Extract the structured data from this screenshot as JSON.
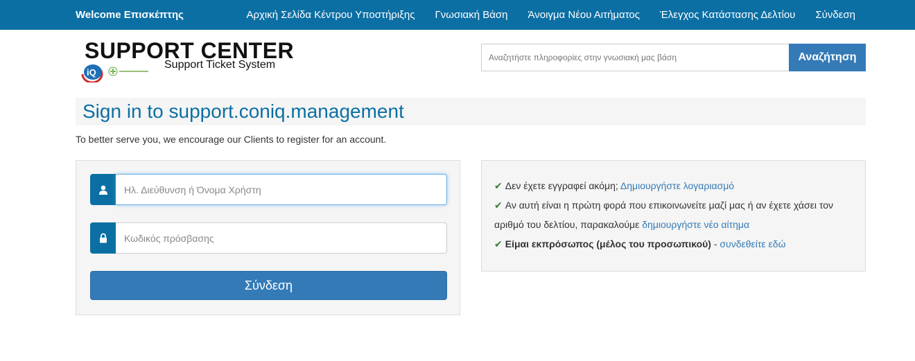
{
  "topbar": {
    "welcome": "Welcome Επισκέπτης",
    "nav": [
      "Αρχική Σελίδα Κέντρου Υποστήριξης",
      "Γνωσιακή Βάση",
      "Άνοιγμα Νέου Αιτήματος",
      "Έλεγχος Κατάστασης Δελτίου",
      "Σύνδεση"
    ]
  },
  "logo": {
    "brand": "SUPPORT CENTER",
    "tagline": "Support Ticket System",
    "badge": "iQ"
  },
  "search": {
    "placeholder": "Αναζητήστε πληροφορίες στην γνωσιακή μας βάση",
    "button": "Αναζήτηση"
  },
  "page": {
    "title": "Sign in to support.coniq.management",
    "intro": "To better serve you, we encourage our Clients to register for an account."
  },
  "login": {
    "username_placeholder": "Ηλ. Διεύθυνση ή Όνομα Χρήστη",
    "password_placeholder": "Κωδικός πρόσβασης",
    "submit": "Σύνδεση"
  },
  "info": {
    "line1_text": "Δεν έχετε εγγραφεί ακόμη;",
    "line1_link": "Δημιουργήστε λογαριασμό",
    "line2_text": "Αν αυτή είναι η πρώτη φορά που επικοινωνείτε μαζί μας ή αν έχετε χάσει τον αριθμό του δελτίου, παρακαλούμε",
    "line2_link": "δημιουργήστε νέο αίτημα",
    "line3_bold": "Είμαι εκπρόσωπος (μέλος του προσωπικού)",
    "line3_sep": "-",
    "line3_link": "συνδεθείτε εδώ"
  },
  "colors": {
    "topbar": "#0b6fa4",
    "primary": "#337ab7",
    "check": "#3a7d3a"
  },
  "icons": [
    "user-icon",
    "lock-icon",
    "check-icon"
  ]
}
